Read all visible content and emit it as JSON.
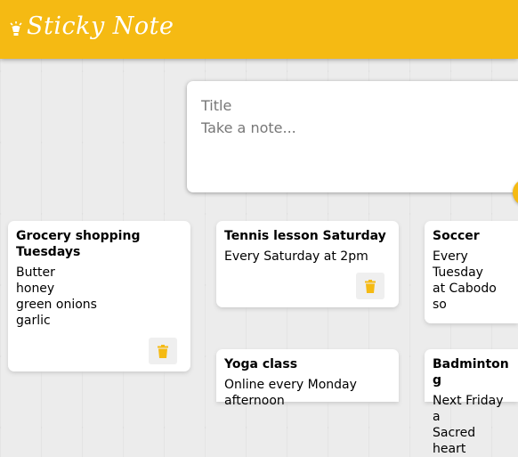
{
  "header": {
    "app_title": "Sticky Note",
    "logo_icon": "lightbulb-icon"
  },
  "create": {
    "title_placeholder": "Title",
    "content_placeholder": "Take a note..."
  },
  "notes": [
    {
      "title": "Grocery shopping Tuesdays",
      "content": "Butter\nhoney\ngreen onions\ngarlic"
    },
    {
      "title": "Tennis lesson Saturday",
      "content": "Every Saturday at 2pm"
    },
    {
      "title": "Soccer",
      "content": "Every Tuesday\nat Cabodo so"
    },
    {
      "title": "Yoga class",
      "content": "Online every Monday\nafternoon"
    },
    {
      "title": "Badminton g",
      "content": "Next Friday a\nSacred heart"
    }
  ],
  "colors": {
    "brand": "#f5ba13",
    "background": "#ececec"
  }
}
